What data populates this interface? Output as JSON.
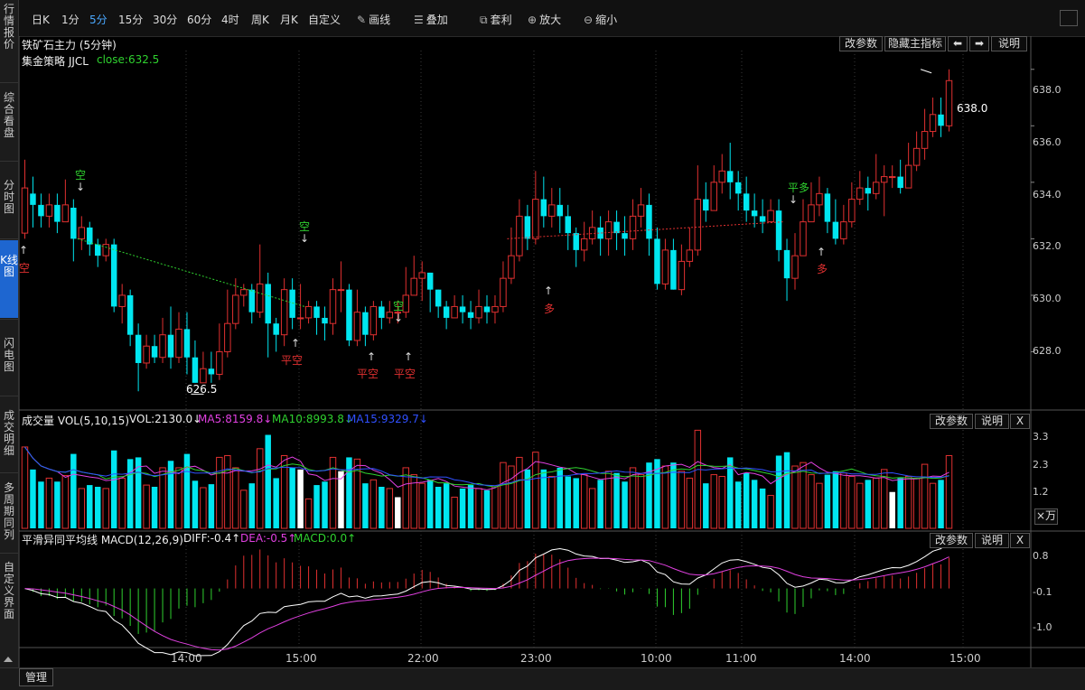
{
  "sidebar": {
    "items": [
      {
        "label": "行情报价",
        "active": false
      },
      {
        "label": "综合看盘",
        "active": false
      },
      {
        "label": "分时图",
        "active": false
      },
      {
        "label": "K线图",
        "active": true
      },
      {
        "label": "闪电图",
        "active": false
      },
      {
        "label": "成交明细",
        "active": false
      },
      {
        "label": "多周期同列",
        "active": false
      },
      {
        "label": "自定义界面",
        "active": false
      }
    ]
  },
  "toolbar": {
    "periods": [
      "日K",
      "1分",
      "5分",
      "15分",
      "30分",
      "60分",
      "4时",
      "周K",
      "月K",
      "自定义"
    ],
    "active_period": "5分",
    "draw_label": "画线",
    "overlay_label": "叠加",
    "arb_label": "套利",
    "zoom_in_label": "放大",
    "zoom_out_label": "缩小"
  },
  "main_panel": {
    "title": "铁矿石主力 (5分钟)",
    "strategy": "集金策略 JJCL",
    "close_text": "close:632.5",
    "buttons": {
      "params": "改参数",
      "hide": "隐藏主指标",
      "help": "说明"
    },
    "high_label": "638.0",
    "low_label": "626.5",
    "price_ticks": [
      "638.0",
      "636.0",
      "634.0",
      "632.0",
      "630.0",
      "628.0"
    ]
  },
  "volume_panel": {
    "title": "成交量 VOL(5,10,15)",
    "vol_text": "VOL:2130.0↓",
    "ma5_text": "MA5:8159.8↓",
    "ma10_text": "MA10:8993.8↓",
    "ma15_text": "MA15:9329.7↓",
    "buttons": {
      "params": "改参数",
      "help": "说明",
      "close": "X"
    },
    "ticks": [
      "3.3",
      "2.3",
      "1.2"
    ],
    "unit": "×万"
  },
  "macd_panel": {
    "title": "平滑异同平均线 MACD(12,26,9)",
    "diff_text": "DIFF:-0.4↑",
    "dea_text": "DEA:-0.5↑",
    "macd_text": "MACD:0.0↑",
    "buttons": {
      "params": "改参数",
      "help": "说明",
      "close": "X"
    },
    "ticks": [
      "0.8",
      "-0.1",
      "-1.0"
    ]
  },
  "time_axis": [
    "14:00",
    "15:00",
    "22:00",
    "23:00",
    "10:00",
    "11:00",
    "14:00",
    "15:00"
  ],
  "annotations": [
    {
      "text": "空",
      "color": "#2fd12f",
      "arrow": "↓"
    },
    {
      "text": "空",
      "color": "#2fd12f",
      "arrow": "↓"
    },
    {
      "text": "空",
      "color": "#2fd12f",
      "arrow": "↓"
    },
    {
      "text": "平多",
      "color": "#2fd12f",
      "arrow": "↓"
    },
    {
      "text": "空",
      "color": "#e03030",
      "arrow": "↑"
    },
    {
      "text": "平空",
      "color": "#e03030",
      "arrow": "↑"
    },
    {
      "text": "平空",
      "color": "#e03030",
      "arrow": "↑"
    },
    {
      "text": "平空",
      "color": "#e03030",
      "arrow": "↑"
    },
    {
      "text": "多",
      "color": "#e03030",
      "arrow": "↑"
    },
    {
      "text": "多",
      "color": "#e03030",
      "arrow": "↑"
    }
  ],
  "bottom": {
    "manage_label": "管理"
  },
  "colors": {
    "up": "#e03030",
    "down": "#00e6f0",
    "ma5": "#e040e0",
    "ma10": "#2fd12f",
    "ma15": "#3050ff"
  },
  "chart_data": {
    "type": "candlestick",
    "candles": [
      [
        632.2,
        633.8,
        634.8,
        632.0
      ],
      [
        633.6,
        633.2,
        634.2,
        632.4
      ],
      [
        633.2,
        632.8,
        633.6,
        632.4
      ],
      [
        632.8,
        633.2,
        633.6,
        632.4
      ],
      [
        633.2,
        632.6,
        633.6,
        632.2
      ],
      [
        632.6,
        633.2,
        634.1,
        632.6
      ],
      [
        633.1,
        632.0,
        633.4,
        631.2
      ],
      [
        632.0,
        632.4,
        632.8,
        631.6
      ],
      [
        632.4,
        631.8,
        632.6,
        631.4
      ],
      [
        631.8,
        631.4,
        632.0,
        631.0
      ],
      [
        631.4,
        631.8,
        632.0,
        631.2
      ],
      [
        631.8,
        629.6,
        632.0,
        629.4
      ],
      [
        629.6,
        630.0,
        630.4,
        629.0
      ],
      [
        630.0,
        628.6,
        630.2,
        628.2
      ],
      [
        628.6,
        627.6,
        629.0,
        626.6
      ],
      [
        627.6,
        628.2,
        628.6,
        627.4
      ],
      [
        628.2,
        627.8,
        628.6,
        627.6
      ],
      [
        627.8,
        628.6,
        629.2,
        627.6
      ],
      [
        628.6,
        627.8,
        629.6,
        627.4
      ],
      [
        627.8,
        628.8,
        629.4,
        627.6
      ],
      [
        628.8,
        627.8,
        629.4,
        627.2
      ],
      [
        627.8,
        626.9,
        628.4,
        626.9
      ],
      [
        626.9,
        627.4,
        628.0,
        626.9
      ],
      [
        627.4,
        627.2,
        628.0,
        626.9
      ],
      [
        627.2,
        628.0,
        629.0,
        627.0
      ],
      [
        628.0,
        629.0,
        630.2,
        627.8
      ],
      [
        629.0,
        630.0,
        630.6,
        628.8
      ],
      [
        630.0,
        630.2,
        630.4,
        629.6
      ],
      [
        630.2,
        629.4,
        630.4,
        629.0
      ],
      [
        629.4,
        630.4,
        631.8,
        629.2
      ],
      [
        630.4,
        629.0,
        630.8,
        627.8
      ],
      [
        629.0,
        628.6,
        629.2,
        628.0
      ],
      [
        628.6,
        630.2,
        630.6,
        628.2
      ],
      [
        630.2,
        629.2,
        630.6,
        628.8
      ],
      [
        629.2,
        629.2,
        630.4,
        628.8
      ],
      [
        629.2,
        629.6,
        629.8,
        629.0
      ],
      [
        629.6,
        629.2,
        629.8,
        628.6
      ],
      [
        629.2,
        629.0,
        629.6,
        628.4
      ],
      [
        629.0,
        630.2,
        630.6,
        628.6
      ],
      [
        630.2,
        630.2,
        631.2,
        629.4
      ],
      [
        630.2,
        628.4,
        630.4,
        628.2
      ],
      [
        628.4,
        629.4,
        630.2,
        628.2
      ],
      [
        629.4,
        628.6,
        629.6,
        628.2
      ],
      [
        628.6,
        629.6,
        629.8,
        628.4
      ],
      [
        629.6,
        629.2,
        629.8,
        628.8
      ],
      [
        629.2,
        629.4,
        629.8,
        629.0
      ],
      [
        629.4,
        629.4,
        629.8,
        629.0
      ],
      [
        629.4,
        630.0,
        631.0,
        629.2
      ],
      [
        630.0,
        630.6,
        631.4,
        630.0
      ],
      [
        630.6,
        630.8,
        631.2,
        629.8
      ],
      [
        630.8,
        630.2,
        630.8,
        629.4
      ],
      [
        630.2,
        629.6,
        630.2,
        629.2
      ],
      [
        629.6,
        629.2,
        629.8,
        628.8
      ],
      [
        629.2,
        629.6,
        630.0,
        629.2
      ],
      [
        629.6,
        629.4,
        630.0,
        629.0
      ],
      [
        629.4,
        629.2,
        629.8,
        628.8
      ],
      [
        629.2,
        629.6,
        630.2,
        629.0
      ],
      [
        629.6,
        629.4,
        630.0,
        629.0
      ],
      [
        629.4,
        629.6,
        630.0,
        629.0
      ],
      [
        629.6,
        630.6,
        631.2,
        629.4
      ],
      [
        630.6,
        631.4,
        632.4,
        630.4
      ],
      [
        631.4,
        632.8,
        633.4,
        631.2
      ],
      [
        632.8,
        632.0,
        633.2,
        631.6
      ],
      [
        632.0,
        633.4,
        634.4,
        631.8
      ],
      [
        633.4,
        632.8,
        634.2,
        632.4
      ],
      [
        632.8,
        633.2,
        633.8,
        632.4
      ],
      [
        633.2,
        632.8,
        633.8,
        632.2
      ],
      [
        632.8,
        632.2,
        633.2,
        631.6
      ],
      [
        632.2,
        631.6,
        632.4,
        631.0
      ],
      [
        631.6,
        632.0,
        632.6,
        631.2
      ],
      [
        632.0,
        632.4,
        633.0,
        631.8
      ],
      [
        632.4,
        632.0,
        632.8,
        631.4
      ],
      [
        632.0,
        632.6,
        633.0,
        631.4
      ],
      [
        632.6,
        632.2,
        633.0,
        631.6
      ],
      [
        632.2,
        632.0,
        632.8,
        631.4
      ],
      [
        632.0,
        632.8,
        633.4,
        631.6
      ],
      [
        632.8,
        633.2,
        633.8,
        632.4
      ],
      [
        633.2,
        632.0,
        633.6,
        631.4
      ],
      [
        632.0,
        630.4,
        632.4,
        630.2
      ],
      [
        630.4,
        631.6,
        632.0,
        630.2
      ],
      [
        631.6,
        630.2,
        632.0,
        630.2
      ],
      [
        630.2,
        631.2,
        631.8,
        630.0
      ],
      [
        631.2,
        631.6,
        632.4,
        631.0
      ],
      [
        631.6,
        633.4,
        634.6,
        631.4
      ],
      [
        633.4,
        633.0,
        634.0,
        632.6
      ],
      [
        633.0,
        634.0,
        634.6,
        633.0
      ],
      [
        634.0,
        634.4,
        635.0,
        633.6
      ],
      [
        634.4,
        634.0,
        635.4,
        633.4
      ],
      [
        634.0,
        633.6,
        634.4,
        633.0
      ],
      [
        633.6,
        633.0,
        634.2,
        632.6
      ],
      [
        633.0,
        632.8,
        633.6,
        632.4
      ],
      [
        632.8,
        632.6,
        633.4,
        632.2
      ],
      [
        632.6,
        633.0,
        633.4,
        632.6
      ],
      [
        633.0,
        631.6,
        633.4,
        631.2
      ],
      [
        631.6,
        630.6,
        632.0,
        629.8
      ],
      [
        630.6,
        631.4,
        632.2,
        630.2
      ],
      [
        631.4,
        632.6,
        633.4,
        631.4
      ],
      [
        632.6,
        633.2,
        634.0,
        632.6
      ],
      [
        633.2,
        633.6,
        634.2,
        632.8
      ],
      [
        633.6,
        632.6,
        633.8,
        632.2
      ],
      [
        632.6,
        632.0,
        633.4,
        631.8
      ],
      [
        632.0,
        632.6,
        633.2,
        631.8
      ],
      [
        632.6,
        633.4,
        634.0,
        632.4
      ],
      [
        633.4,
        633.8,
        634.4,
        633.2
      ],
      [
        633.8,
        633.6,
        634.2,
        633.0
      ],
      [
        633.6,
        634.0,
        635.0,
        633.4
      ],
      [
        634.0,
        634.2,
        634.6,
        632.8
      ],
      [
        634.2,
        634.2,
        634.6,
        633.8
      ],
      [
        634.2,
        633.8,
        634.8,
        633.6
      ],
      [
        633.8,
        634.6,
        635.4,
        633.8
      ],
      [
        634.6,
        635.2,
        635.8,
        634.4
      ],
      [
        635.2,
        635.8,
        636.6,
        634.8
      ],
      [
        635.8,
        636.4,
        637.0,
        635.6
      ],
      [
        636.4,
        636.0,
        637.0,
        635.6
      ],
      [
        636.0,
        637.6,
        638.0,
        635.8
      ]
    ],
    "high_marker": 638.0,
    "low_marker": 626.5,
    "price_range": [
      626.0,
      638.6
    ],
    "volume_range": [
      0,
      3.6
    ],
    "macd_range": [
      -1.3,
      1.0
    ]
  }
}
